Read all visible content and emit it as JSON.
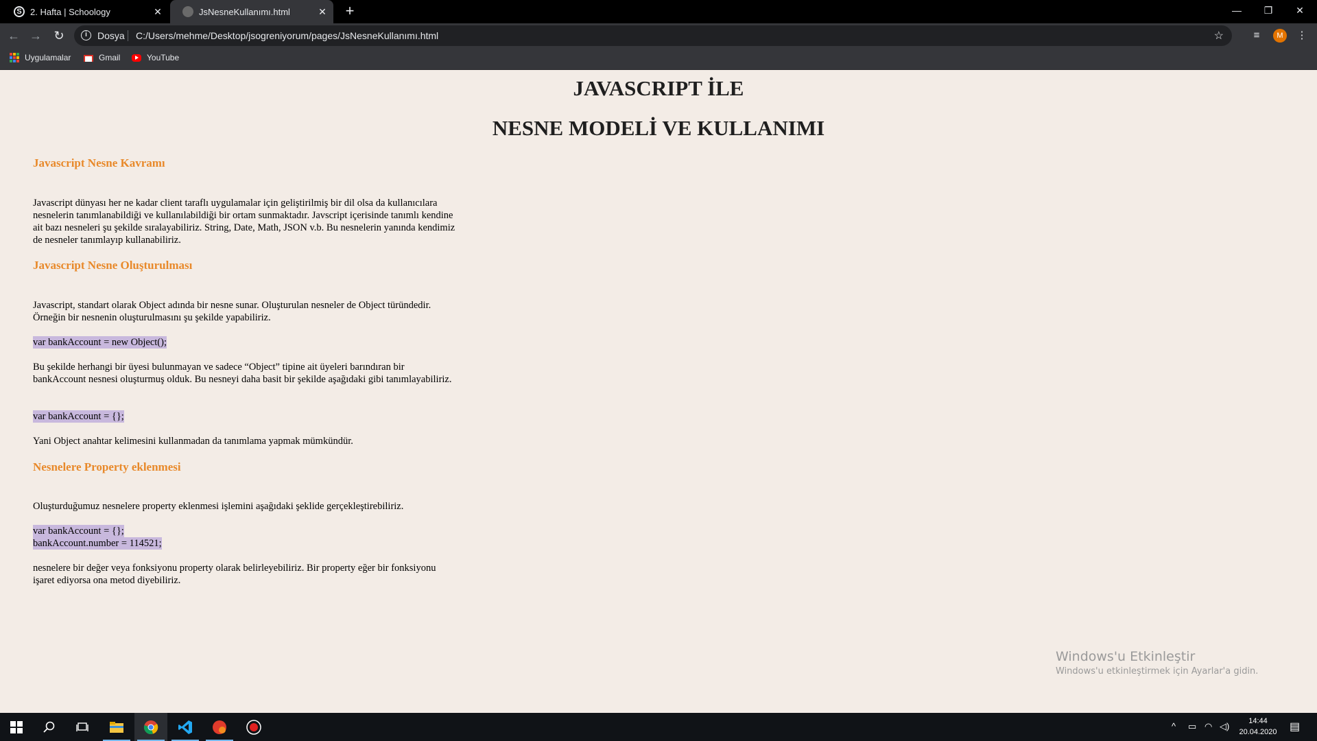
{
  "browser": {
    "tabs": [
      {
        "title": "2. Hafta | Schoology",
        "favicon": "S",
        "active": false
      },
      {
        "title": "JsNesneKullanımı.html",
        "favicon": "",
        "active": true
      }
    ],
    "new_tab": "+",
    "window_controls": {
      "minimize": "—",
      "restore": "❐",
      "close": "✕"
    },
    "omnibox": {
      "scheme_label": "Dosya",
      "url": "C:/Users/mehme/Desktop/jsogreniyorum/pages/JsNesneKullanımı.html"
    },
    "profile_initial": "M",
    "bookmarks": [
      {
        "label": "Uygulamalar",
        "icon": "apps-icon"
      },
      {
        "label": "Gmail",
        "icon": "gmail-icon"
      },
      {
        "label": "YouTube",
        "icon": "youtube-icon"
      }
    ]
  },
  "page": {
    "title_line1": "JAVASCRIPT İLE",
    "title_line2": "NESNE MODELİ VE KULLANIMI",
    "sections": [
      {
        "heading": "Javascript Nesne Kavramı",
        "para": "Javascript dünyası her ne kadar client taraflı uygulamalar için geliştirilmiş bir dil olsa da kullanıcılara nesnelerin tanımlanabildiği ve kullanılabildiği bir ortam sunmaktadır. Javscript içerisinde tanımlı kendine ait bazı nesneleri şu şekilde sıralayabiliriz. String, Date, Math, JSON v.b. Bu nesnelerin yanında kendimiz de nesneler tanımlayıp kullanabiliriz."
      },
      {
        "heading": "Javascript Nesne Oluşturulması",
        "para1": "Javascript, standart olarak Object adında bir nesne sunar. Oluşturulan nesneler de Object türündedir. Örneğin bir nesnenin oluşturulmasını şu şekilde yapabiliriz.",
        "code1": "var bankAccount = new Object();",
        "para2": "Bu şekilde herhangi bir üyesi bulunmayan ve sadece “Object” tipine ait üyeleri barındıran bir bankAccount nesnesi oluşturmuş olduk. Bu nesneyi daha basit bir şekilde aşağıdaki gibi tanımlayabiliriz.",
        "code2": "var bankAccount = {};",
        "para3": "Yani Object anahtar kelimesini kullanmadan da tanımlama yapmak mümkündür."
      },
      {
        "heading": "Nesnelere Property eklenmesi",
        "para1": "Oluşturduğumuz nesnelere property eklenmesi işlemini aşağıdaki şeklide gerçekleştirebiliriz.",
        "code_line1": "var bankAccount = {};",
        "code_line2": "bankAccount.number = 114521;",
        "para2": "nesnelere bir değer veya fonksiyonu property olarak belirleyebiliriz. Bir property eğer bir fonksiyonu işaret ediyorsa ona metod diyebiliriz."
      }
    ]
  },
  "watermark": {
    "line1": "Windows'u Etkinleştir",
    "line2": "Windows'u etkinleştirmek için Ayarlar'a gidin."
  },
  "taskbar": {
    "time": "14:44",
    "date": "20.04.2020"
  },
  "colors": {
    "heading_accent": "#e8892a",
    "code_highlight": "#c8b8dd",
    "page_background": "#f3ece6"
  }
}
